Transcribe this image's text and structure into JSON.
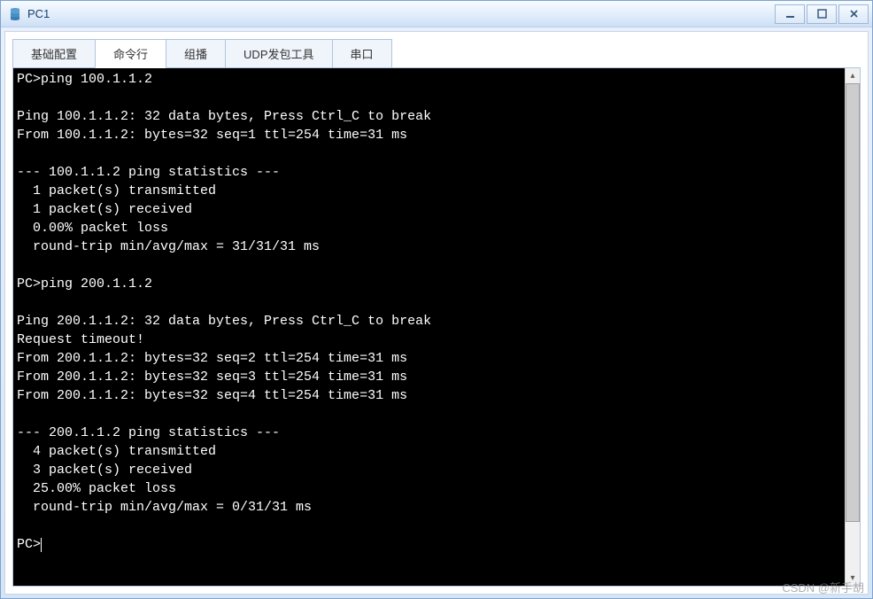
{
  "window": {
    "title": "PC1"
  },
  "tabs": [
    {
      "label": "基础配置",
      "active": false
    },
    {
      "label": "命令行",
      "active": true
    },
    {
      "label": "组播",
      "active": false
    },
    {
      "label": "UDP发包工具",
      "active": false
    },
    {
      "label": "串口",
      "active": false
    }
  ],
  "terminal": {
    "lines": [
      "PC>ping 100.1.1.2",
      "",
      "Ping 100.1.1.2: 32 data bytes, Press Ctrl_C to break",
      "From 100.1.1.2: bytes=32 seq=1 ttl=254 time=31 ms",
      "",
      "--- 100.1.1.2 ping statistics ---",
      "  1 packet(s) transmitted",
      "  1 packet(s) received",
      "  0.00% packet loss",
      "  round-trip min/avg/max = 31/31/31 ms",
      "",
      "PC>ping 200.1.1.2",
      "",
      "Ping 200.1.1.2: 32 data bytes, Press Ctrl_C to break",
      "Request timeout!",
      "From 200.1.1.2: bytes=32 seq=2 ttl=254 time=31 ms",
      "From 200.1.1.2: bytes=32 seq=3 ttl=254 time=31 ms",
      "From 200.1.1.2: bytes=32 seq=4 ttl=254 time=31 ms",
      "",
      "--- 200.1.1.2 ping statistics ---",
      "  4 packet(s) transmitted",
      "  3 packet(s) received",
      "  25.00% packet loss",
      "  round-trip min/avg/max = 0/31/31 ms",
      "",
      "PC>"
    ],
    "prompt_cursor": true
  },
  "watermark": "CSDN @新手胡"
}
